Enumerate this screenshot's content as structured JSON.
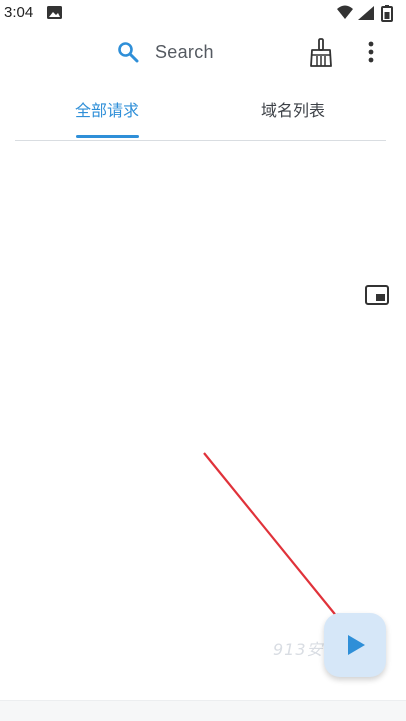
{
  "status_bar": {
    "time": "3:04",
    "icons": [
      "image-icon",
      "wifi-icon",
      "signal-icon",
      "battery-icon"
    ]
  },
  "app_bar": {
    "search_label": "Search",
    "icons": [
      "search-icon",
      "broom-icon",
      "more-vert-icon"
    ]
  },
  "tabs": [
    {
      "label": "全部请求",
      "selected": true
    },
    {
      "label": "域名列表",
      "selected": false
    }
  ],
  "fab": {
    "icon": "play-icon"
  },
  "watermark": "913安",
  "colors": {
    "accent": "#2f8fd8",
    "fab_bg": "#d6e7f8",
    "arrow": "#e0323a"
  }
}
